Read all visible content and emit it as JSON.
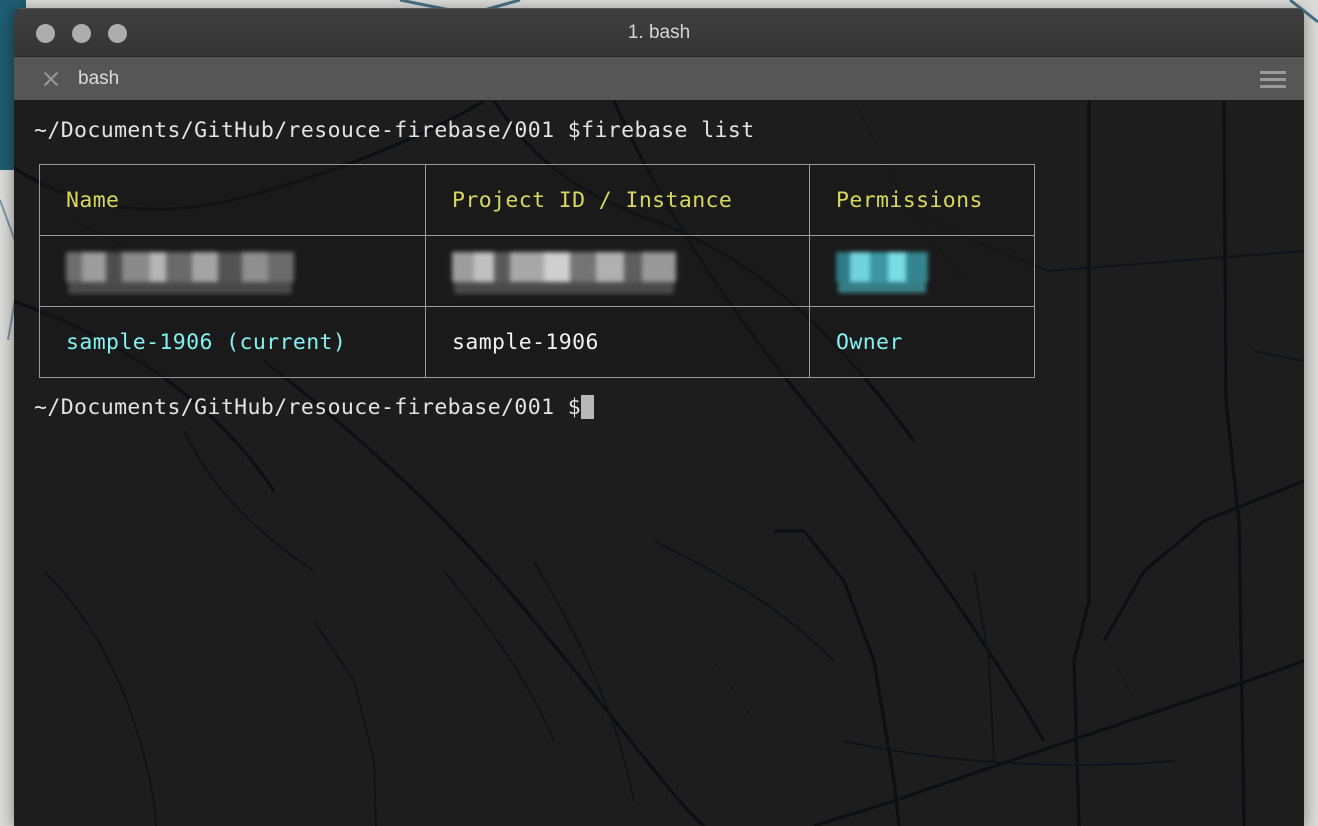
{
  "window": {
    "title": "1. bash",
    "traffic_lights": [
      "close",
      "minimize",
      "zoom"
    ]
  },
  "tabbar": {
    "close_icon": "close-icon",
    "tab_label": "bash",
    "menu_icon": "hamburger-icon"
  },
  "terminal": {
    "prompt_line_1": "~/Documents/GitHub/resouce-firebase/001 $firebase list",
    "prompt_line_2": "~/Documents/GitHub/resouce-firebase/001 $",
    "cursor": "block"
  },
  "table": {
    "headers": [
      "Name",
      "Project ID / Instance",
      "Permissions"
    ],
    "rows": [
      {
        "name": "",
        "project_id": "",
        "permissions": "",
        "redacted": true
      },
      {
        "name": "sample-1906 (current)",
        "project_id": "sample-1906",
        "permissions": "Owner",
        "redacted": false
      }
    ]
  },
  "colors": {
    "header_yellow": "#d8d85c",
    "cyan": "#82f2f2",
    "white": "#f2f2f2",
    "titlebar": "#3b3b3b",
    "tabbar": "#565656",
    "terminal_bg": "#1d1d1d",
    "border": "#9a9a9a"
  }
}
